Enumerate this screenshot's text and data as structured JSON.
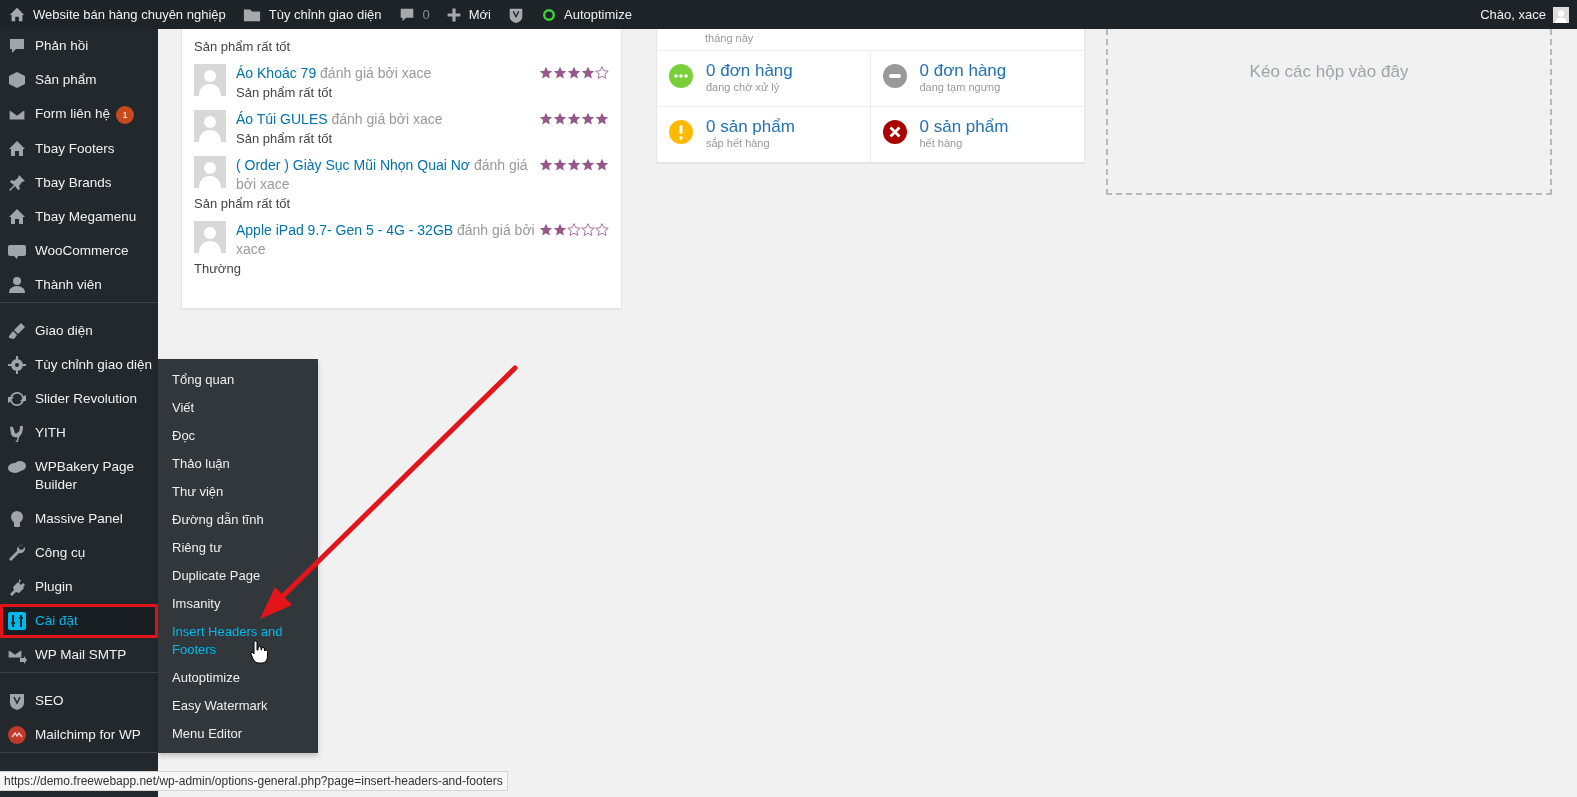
{
  "admin_bar": {
    "site_title": "Website bán hàng chuyên nghiệp",
    "customize": "Tùy chỉnh giao diện",
    "comments_count": "0",
    "new_label": "Mới",
    "autoptimize": "Autoptimize",
    "greeting": "Chào, xace"
  },
  "sidebar": {
    "items": [
      {
        "kind": "item",
        "label": "Phản hồi",
        "selected": false
      },
      {
        "kind": "item",
        "label": "Sản phẩm",
        "selected": false
      },
      {
        "kind": "item",
        "label": "Form liên hệ",
        "badge": "1",
        "selected": false
      },
      {
        "kind": "item",
        "label": "Tbay Footers",
        "selected": false
      },
      {
        "kind": "item",
        "label": "Tbay Brands",
        "selected": false
      },
      {
        "kind": "item",
        "label": "Tbay Megamenu",
        "selected": false
      },
      {
        "kind": "item",
        "label": "WooCommerce",
        "selected": false
      },
      {
        "kind": "item",
        "label": "Thành viên",
        "selected": false
      },
      {
        "kind": "separator"
      },
      {
        "kind": "item",
        "label": "Giao diện",
        "selected": false
      },
      {
        "kind": "item",
        "label": "Tùy chỉnh giao diện",
        "selected": false
      },
      {
        "kind": "item",
        "label": "Slider Revolution",
        "selected": false
      },
      {
        "kind": "item",
        "label": "YITH",
        "selected": false
      },
      {
        "kind": "item",
        "label": "WPBakery Page Builder",
        "selected": false
      },
      {
        "kind": "item",
        "label": "Massive Panel",
        "selected": false
      },
      {
        "kind": "item",
        "label": "Công cụ",
        "selected": false
      },
      {
        "kind": "item",
        "label": "Plugin",
        "selected": false
      },
      {
        "kind": "item",
        "label": "Cài đặt",
        "selected": true,
        "highlighted": true
      },
      {
        "kind": "item",
        "label": "WP Mail SMTP",
        "selected": false
      },
      {
        "kind": "separator"
      },
      {
        "kind": "item",
        "label": "SEO",
        "selected": false
      },
      {
        "kind": "item",
        "label": "Mailchimp for WP",
        "selected": false
      },
      {
        "kind": "separator"
      }
    ]
  },
  "submenu": {
    "items": [
      {
        "label": "Tổng quan",
        "selected": false
      },
      {
        "label": "Viết",
        "selected": false
      },
      {
        "label": "Đọc",
        "selected": false
      },
      {
        "label": "Thảo luận",
        "selected": false
      },
      {
        "label": "Thư viện",
        "selected": false
      },
      {
        "label": "Đường dẫn tĩnh",
        "selected": false
      },
      {
        "label": "Riêng tư",
        "selected": false
      },
      {
        "label": "Duplicate Page",
        "selected": false
      },
      {
        "label": "Imsanity",
        "selected": false
      },
      {
        "label": "Insert Headers and Footers",
        "selected": true
      },
      {
        "label": "Autoptimize",
        "selected": false
      },
      {
        "label": "Easy Watermark",
        "selected": false
      },
      {
        "label": "Menu Editor",
        "selected": false
      }
    ]
  },
  "reviews": [
    {
      "comment": "Sản phẩm rất tốt"
    },
    {
      "product": "Áo Khoác 79",
      "byline": "đánh giá bởi xace",
      "comment": "Sản phẩm rất tốt",
      "stars": 4
    },
    {
      "product": "Áo Túi GULES",
      "byline": "đánh giá bởi xace",
      "comment": "Sản phẩm rất tốt",
      "stars": 5
    },
    {
      "product": "( Order ) Giày Sục Mũi Nhọn Quai Nơ",
      "byline": "đánh giá bởi xace",
      "comment": "Sản phẩm rất tốt",
      "stars": 5
    },
    {
      "product": "Apple iPad 9.7- Gen 5 - 4G - 32GB",
      "byline": "đánh giá bởi xace",
      "comment": "Thường",
      "stars": 2
    }
  ],
  "status": {
    "top_caption": "tháng này",
    "cells": [
      {
        "kind": "processing",
        "value": "0 đơn hàng",
        "caption": "đang chờ xử lý"
      },
      {
        "kind": "on-hold",
        "value": "0 đơn hàng",
        "caption": "đang tạm ngưng"
      },
      {
        "kind": "low-stock",
        "value": "0 sản phẩm",
        "caption": "sắp hết hàng"
      },
      {
        "kind": "out-of-stock",
        "value": "0 sản phẩm",
        "caption": "hết hàng"
      }
    ]
  },
  "drop_zone": {
    "text": "Kéo các hộp vào đây"
  },
  "status_url": "https://demo.freewebapp.net/wp-admin/options-general.php?page=insert-headers-and-footers"
}
